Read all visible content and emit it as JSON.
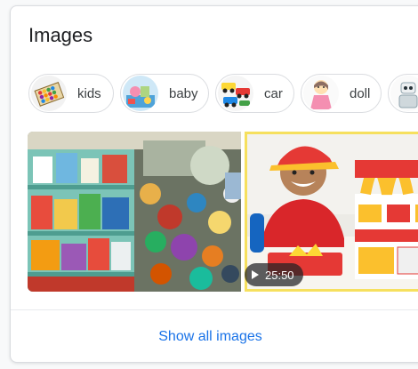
{
  "card": {
    "title": "Images",
    "show_all_label": "Show all images"
  },
  "chips": [
    {
      "label": "kids",
      "thumb": "toy-abacus-thumbnail"
    },
    {
      "label": "baby",
      "thumb": "baby-toys-thumbnail"
    },
    {
      "label": "car",
      "thumb": "toy-cars-thumbnail"
    },
    {
      "label": "doll",
      "thumb": "doll-thumbnail"
    },
    {
      "label": "",
      "thumb": "robot-toy-thumbnail"
    }
  ],
  "images": [
    {
      "name": "toy-store-shelves-image"
    },
    {
      "name": "kid-mcdonalds-playset-video",
      "duration": "25:50"
    }
  ],
  "colors": {
    "link": "#1a73e8",
    "border": "#dadce0",
    "title": "#202124",
    "video_frame": "#f6e05e"
  }
}
